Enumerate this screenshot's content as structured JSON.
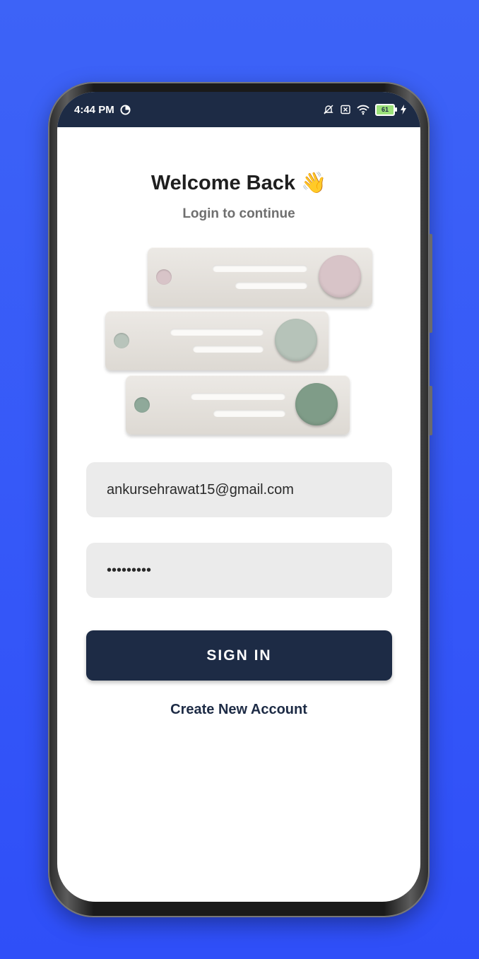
{
  "status_bar": {
    "time": "4:44 PM",
    "battery_level": "61",
    "icons": [
      "data-saver-icon",
      "bell-off-icon",
      "sim-x-icon",
      "wifi-icon",
      "battery-icon",
      "charging-icon"
    ]
  },
  "login": {
    "title": "Welcome Back",
    "title_emoji": "👋",
    "subtitle": "Login to continue",
    "email_value": "ankursehrawat15@gmail.com",
    "password_value": "•••••••••",
    "signin_label": "SIGN IN",
    "create_account_label": "Create New Account"
  },
  "colors": {
    "background": "#3d63f7",
    "primary": "#1d2b45",
    "field_bg": "#ebebeb",
    "card_dot_pink": "#d8c4c8",
    "card_dot_sage": "#b8c4bb",
    "card_dot_green": "#8fa99a"
  }
}
